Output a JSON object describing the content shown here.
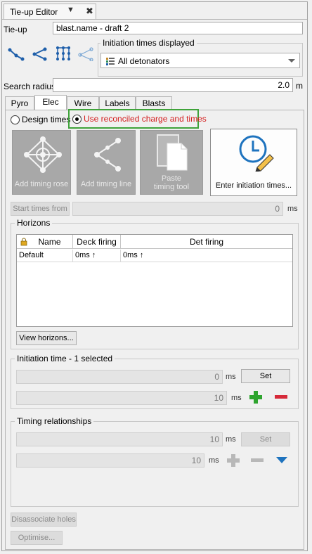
{
  "window": {
    "tab_title": "Tie-up Editor",
    "pin_glyph": "▼",
    "close_glyph": "✖"
  },
  "tieup": {
    "label": "Tie-up",
    "value": "blast.name - draft 2"
  },
  "initiation": {
    "group_title": "Initiation times displayed",
    "selected": "All detonators"
  },
  "search_radius": {
    "label": "Search radius",
    "value": "2.0",
    "unit": "m"
  },
  "tabs": [
    {
      "label": "Pyro"
    },
    {
      "label": "Elec"
    },
    {
      "label": "Wire"
    },
    {
      "label": "Labels"
    },
    {
      "label": "Blasts"
    }
  ],
  "mode": {
    "design": "Design times",
    "reconciled": "Use reconciled charge and times"
  },
  "tools": {
    "add_rose": "Add timing rose",
    "add_line": "Add timing line",
    "paste_line1": "Paste",
    "paste_line2": "timing tool",
    "enter_times": "Enter initiation times..."
  },
  "start_times": {
    "label": "Start times from",
    "value": "0",
    "unit": "ms"
  },
  "horizons": {
    "title": "Horizons",
    "columns": [
      "Name",
      "Deck firing",
      "Det firing"
    ],
    "rows": [
      {
        "name": "Default",
        "deck": "0ms ↑",
        "det": "0ms ↑"
      }
    ],
    "view_button": "View horizons..."
  },
  "initiation_time": {
    "title": "Initiation time - 1 selected",
    "value1": "0",
    "unit1": "ms",
    "set_label": "Set",
    "value2": "10",
    "unit2": "ms"
  },
  "timing_relationships": {
    "title": "Timing relationships",
    "value1": "10",
    "unit1": "ms",
    "set_label": "Set",
    "value2": "10",
    "unit2": "ms"
  },
  "bottom": {
    "disassociate": "Disassociate holes",
    "optimise": "Optimise..."
  },
  "colors": {
    "accent_blue": "#1f5faa",
    "highlight_green": "#3fa33a",
    "reconciled_red": "#d42020",
    "plus_green": "#2ea42e",
    "minus_red": "#d62a3a"
  }
}
